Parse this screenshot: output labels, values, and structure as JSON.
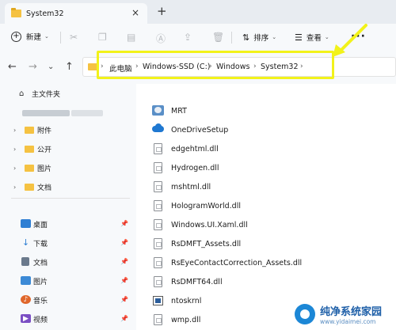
{
  "window": {
    "tab_title": "System32",
    "close_glyph": "×",
    "new_tab_glyph": "+"
  },
  "commandbar": {
    "new_label": "新建",
    "sort_label": "排序",
    "view_label": "查看",
    "more_glyph": "···"
  },
  "address": {
    "crumbs": [
      "此电脑",
      "Windows-SSD (C:)",
      "Windows",
      "System32"
    ],
    "separator": "›",
    "highlight_color": "#f2f21a"
  },
  "sidebar": {
    "home_label": "主文件夹",
    "tree_folders": [
      "附件",
      "公开",
      "图片",
      "文档"
    ],
    "quick_access": [
      {
        "label": "桌面",
        "icon": "desktop-icon",
        "color": "#2f7fd3"
      },
      {
        "label": "下载",
        "icon": "download-icon",
        "color": "#2f7fd3"
      },
      {
        "label": "文档",
        "icon": "documents-icon",
        "color": "#6b7a8c"
      },
      {
        "label": "图片",
        "icon": "pictures-icon",
        "color": "#3c8ad6"
      },
      {
        "label": "音乐",
        "icon": "music-icon",
        "color": "#e0672b"
      },
      {
        "label": "视频",
        "icon": "videos-icon",
        "color": "#7b4fc4"
      }
    ]
  },
  "files": [
    {
      "name": "MRT",
      "icon": "mrt-icon"
    },
    {
      "name": "OneDriveSetup",
      "icon": "onedrive-icon"
    },
    {
      "name": "edgehtml.dll",
      "icon": "dll-icon"
    },
    {
      "name": "Hydrogen.dll",
      "icon": "dll-icon"
    },
    {
      "name": "mshtml.dll",
      "icon": "dll-icon"
    },
    {
      "name": "HologramWorld.dll",
      "icon": "dll-icon"
    },
    {
      "name": "Windows.UI.Xaml.dll",
      "icon": "dll-icon"
    },
    {
      "name": "RsDMFT_Assets.dll",
      "icon": "dll-icon"
    },
    {
      "name": "RsEyeContactCorrection_Assets.dll",
      "icon": "dll-icon"
    },
    {
      "name": "RsDMFT64.dll",
      "icon": "dll-icon"
    },
    {
      "name": "ntoskrnl",
      "icon": "ntoskrnl-icon"
    },
    {
      "name": "wmp.dll",
      "icon": "dll-icon"
    }
  ],
  "watermark": {
    "main": "纯净系统家园",
    "url": "www.yidaimei.com"
  }
}
